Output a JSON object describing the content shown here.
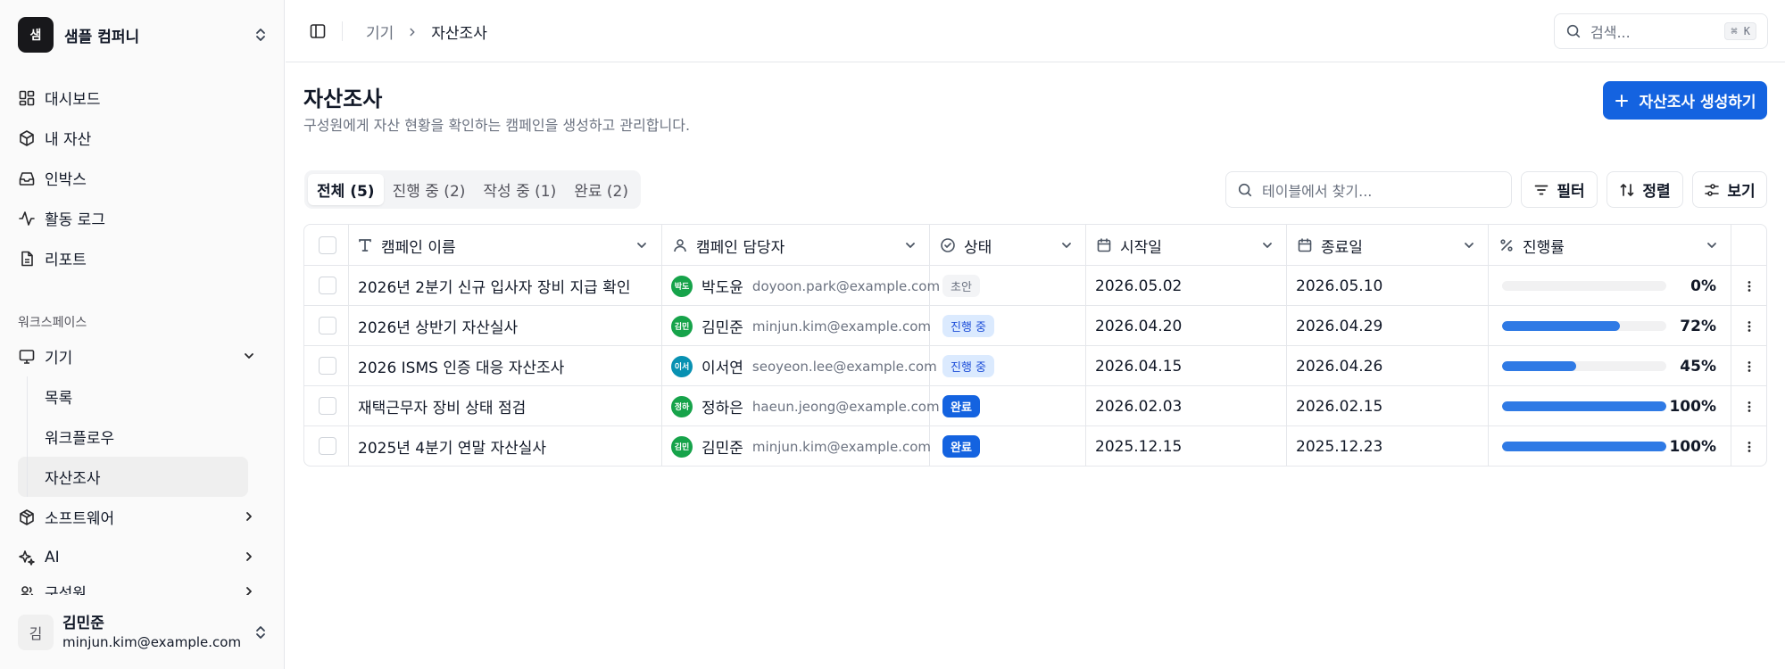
{
  "org": {
    "logo": "샘",
    "name": "샘플 컴퍼니"
  },
  "nav": {
    "items": [
      {
        "label": "대시보드",
        "icon": "dashboard-icon"
      },
      {
        "label": "내 자산",
        "icon": "box-icon"
      },
      {
        "label": "인박스",
        "icon": "inbox-icon"
      },
      {
        "label": "활동 로그",
        "icon": "activity-icon"
      },
      {
        "label": "리포트",
        "icon": "report-icon"
      }
    ],
    "workspace_label": "워크스페이스",
    "devices": {
      "label": "기기",
      "icon": "monitor-icon",
      "expanded": true
    },
    "device_subitems": [
      {
        "label": "목록",
        "active": false
      },
      {
        "label": "워크플로우",
        "active": false
      },
      {
        "label": "자산조사",
        "active": true
      }
    ],
    "software": {
      "label": "소프트웨어",
      "icon": "package-icon"
    },
    "ai": {
      "label": "AI",
      "icon": "sparkles-icon"
    },
    "members": {
      "label": "구성원",
      "icon": "users-icon"
    }
  },
  "user": {
    "avatar": "김",
    "name": "김민준",
    "email": "minjun.kim@example.com"
  },
  "topbar": {
    "breadcrumb_parent": "기기",
    "breadcrumb_current": "자산조사",
    "search_placeholder": "검색...",
    "search_shortcut": "⌘ K"
  },
  "page": {
    "title": "자산조사",
    "description": "구성원에게 자산 현황을 확인하는 캠페인을 생성하고 관리합니다.",
    "create_button": "자산조사 생성하기"
  },
  "tabs": [
    {
      "label": "전체 (5)",
      "active": true
    },
    {
      "label": "진행 중 (2)",
      "active": false
    },
    {
      "label": "작성 중 (1)",
      "active": false
    },
    {
      "label": "완료 (2)",
      "active": false
    }
  ],
  "toolbar": {
    "search_placeholder": "테이블에서 찾기...",
    "filter_label": "필터",
    "sort_label": "정렬",
    "view_label": "보기"
  },
  "table": {
    "columns": {
      "name": "캠페인 이름",
      "owner": "캠페인 담당자",
      "status": "상태",
      "start": "시작일",
      "end": "종료일",
      "progress": "진행률"
    },
    "rows": [
      {
        "name": "2026년 2분기 신규 입사자 장비 지급 확인",
        "owner_avatar": "박도",
        "owner_color": "#16a34a",
        "owner_name": "박도윤",
        "owner_email": "doyoon.park@example.com",
        "status": "초안",
        "status_kind": "draft",
        "start": "2026.05.02",
        "end": "2026.05.10",
        "progress": 0,
        "progress_label": "0%"
      },
      {
        "name": "2026년 상반기 자산실사",
        "owner_avatar": "김민",
        "owner_color": "#16a34a",
        "owner_name": "김민준",
        "owner_email": "minjun.kim@example.com",
        "status": "진행 중",
        "status_kind": "progress",
        "start": "2026.04.20",
        "end": "2026.04.29",
        "progress": 72,
        "progress_label": "72%"
      },
      {
        "name": "2026 ISMS 인증 대응 자산조사",
        "owner_avatar": "이서",
        "owner_color": "#0891b2",
        "owner_name": "이서연",
        "owner_email": "seoyeon.lee@example.com",
        "status": "진행 중",
        "status_kind": "progress",
        "start": "2026.04.15",
        "end": "2026.04.26",
        "progress": 45,
        "progress_label": "45%"
      },
      {
        "name": "재택근무자 장비 상태 점검",
        "owner_avatar": "정하",
        "owner_color": "#16a34a",
        "owner_name": "정하은",
        "owner_email": "haeun.jeong@example.com",
        "status": "완료",
        "status_kind": "done",
        "start": "2026.02.03",
        "end": "2026.02.15",
        "progress": 100,
        "progress_label": "100%"
      },
      {
        "name": "2025년 4분기 연말 자산실사",
        "owner_avatar": "김민",
        "owner_color": "#16a34a",
        "owner_name": "김민준",
        "owner_email": "minjun.kim@example.com",
        "status": "완료",
        "status_kind": "done",
        "start": "2025.12.15",
        "end": "2025.12.23",
        "progress": 100,
        "progress_label": "100%"
      }
    ]
  },
  "colors": {
    "primary": "#1463e0",
    "progress_bar": "#2f7ae5",
    "avatar_green": "#16a34a",
    "avatar_teal": "#0891b2"
  }
}
